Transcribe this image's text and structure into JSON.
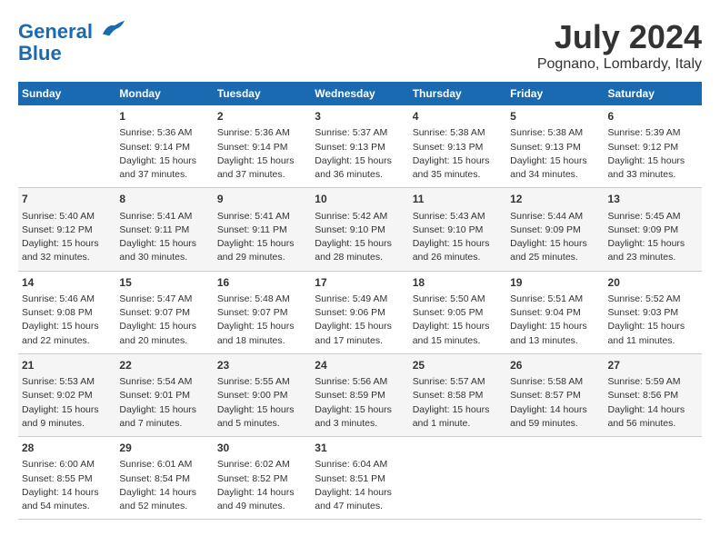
{
  "header": {
    "logo_line1": "General",
    "logo_line2": "Blue",
    "month_year": "July 2024",
    "location": "Pognano, Lombardy, Italy"
  },
  "columns": [
    "Sunday",
    "Monday",
    "Tuesday",
    "Wednesday",
    "Thursday",
    "Friday",
    "Saturday"
  ],
  "weeks": [
    [
      {
        "day": "",
        "sunrise": "",
        "sunset": "",
        "daylight": ""
      },
      {
        "day": "1",
        "sunrise": "Sunrise: 5:36 AM",
        "sunset": "Sunset: 9:14 PM",
        "daylight": "Daylight: 15 hours and 37 minutes."
      },
      {
        "day": "2",
        "sunrise": "Sunrise: 5:36 AM",
        "sunset": "Sunset: 9:14 PM",
        "daylight": "Daylight: 15 hours and 37 minutes."
      },
      {
        "day": "3",
        "sunrise": "Sunrise: 5:37 AM",
        "sunset": "Sunset: 9:13 PM",
        "daylight": "Daylight: 15 hours and 36 minutes."
      },
      {
        "day": "4",
        "sunrise": "Sunrise: 5:38 AM",
        "sunset": "Sunset: 9:13 PM",
        "daylight": "Daylight: 15 hours and 35 minutes."
      },
      {
        "day": "5",
        "sunrise": "Sunrise: 5:38 AM",
        "sunset": "Sunset: 9:13 PM",
        "daylight": "Daylight: 15 hours and 34 minutes."
      },
      {
        "day": "6",
        "sunrise": "Sunrise: 5:39 AM",
        "sunset": "Sunset: 9:12 PM",
        "daylight": "Daylight: 15 hours and 33 minutes."
      }
    ],
    [
      {
        "day": "7",
        "sunrise": "Sunrise: 5:40 AM",
        "sunset": "Sunset: 9:12 PM",
        "daylight": "Daylight: 15 hours and 32 minutes."
      },
      {
        "day": "8",
        "sunrise": "Sunrise: 5:41 AM",
        "sunset": "Sunset: 9:11 PM",
        "daylight": "Daylight: 15 hours and 30 minutes."
      },
      {
        "day": "9",
        "sunrise": "Sunrise: 5:41 AM",
        "sunset": "Sunset: 9:11 PM",
        "daylight": "Daylight: 15 hours and 29 minutes."
      },
      {
        "day": "10",
        "sunrise": "Sunrise: 5:42 AM",
        "sunset": "Sunset: 9:10 PM",
        "daylight": "Daylight: 15 hours and 28 minutes."
      },
      {
        "day": "11",
        "sunrise": "Sunrise: 5:43 AM",
        "sunset": "Sunset: 9:10 PM",
        "daylight": "Daylight: 15 hours and 26 minutes."
      },
      {
        "day": "12",
        "sunrise": "Sunrise: 5:44 AM",
        "sunset": "Sunset: 9:09 PM",
        "daylight": "Daylight: 15 hours and 25 minutes."
      },
      {
        "day": "13",
        "sunrise": "Sunrise: 5:45 AM",
        "sunset": "Sunset: 9:09 PM",
        "daylight": "Daylight: 15 hours and 23 minutes."
      }
    ],
    [
      {
        "day": "14",
        "sunrise": "Sunrise: 5:46 AM",
        "sunset": "Sunset: 9:08 PM",
        "daylight": "Daylight: 15 hours and 22 minutes."
      },
      {
        "day": "15",
        "sunrise": "Sunrise: 5:47 AM",
        "sunset": "Sunset: 9:07 PM",
        "daylight": "Daylight: 15 hours and 20 minutes."
      },
      {
        "day": "16",
        "sunrise": "Sunrise: 5:48 AM",
        "sunset": "Sunset: 9:07 PM",
        "daylight": "Daylight: 15 hours and 18 minutes."
      },
      {
        "day": "17",
        "sunrise": "Sunrise: 5:49 AM",
        "sunset": "Sunset: 9:06 PM",
        "daylight": "Daylight: 15 hours and 17 minutes."
      },
      {
        "day": "18",
        "sunrise": "Sunrise: 5:50 AM",
        "sunset": "Sunset: 9:05 PM",
        "daylight": "Daylight: 15 hours and 15 minutes."
      },
      {
        "day": "19",
        "sunrise": "Sunrise: 5:51 AM",
        "sunset": "Sunset: 9:04 PM",
        "daylight": "Daylight: 15 hours and 13 minutes."
      },
      {
        "day": "20",
        "sunrise": "Sunrise: 5:52 AM",
        "sunset": "Sunset: 9:03 PM",
        "daylight": "Daylight: 15 hours and 11 minutes."
      }
    ],
    [
      {
        "day": "21",
        "sunrise": "Sunrise: 5:53 AM",
        "sunset": "Sunset: 9:02 PM",
        "daylight": "Daylight: 15 hours and 9 minutes."
      },
      {
        "day": "22",
        "sunrise": "Sunrise: 5:54 AM",
        "sunset": "Sunset: 9:01 PM",
        "daylight": "Daylight: 15 hours and 7 minutes."
      },
      {
        "day": "23",
        "sunrise": "Sunrise: 5:55 AM",
        "sunset": "Sunset: 9:00 PM",
        "daylight": "Daylight: 15 hours and 5 minutes."
      },
      {
        "day": "24",
        "sunrise": "Sunrise: 5:56 AM",
        "sunset": "Sunset: 8:59 PM",
        "daylight": "Daylight: 15 hours and 3 minutes."
      },
      {
        "day": "25",
        "sunrise": "Sunrise: 5:57 AM",
        "sunset": "Sunset: 8:58 PM",
        "daylight": "Daylight: 15 hours and 1 minute."
      },
      {
        "day": "26",
        "sunrise": "Sunrise: 5:58 AM",
        "sunset": "Sunset: 8:57 PM",
        "daylight": "Daylight: 14 hours and 59 minutes."
      },
      {
        "day": "27",
        "sunrise": "Sunrise: 5:59 AM",
        "sunset": "Sunset: 8:56 PM",
        "daylight": "Daylight: 14 hours and 56 minutes."
      }
    ],
    [
      {
        "day": "28",
        "sunrise": "Sunrise: 6:00 AM",
        "sunset": "Sunset: 8:55 PM",
        "daylight": "Daylight: 14 hours and 54 minutes."
      },
      {
        "day": "29",
        "sunrise": "Sunrise: 6:01 AM",
        "sunset": "Sunset: 8:54 PM",
        "daylight": "Daylight: 14 hours and 52 minutes."
      },
      {
        "day": "30",
        "sunrise": "Sunrise: 6:02 AM",
        "sunset": "Sunset: 8:52 PM",
        "daylight": "Daylight: 14 hours and 49 minutes."
      },
      {
        "day": "31",
        "sunrise": "Sunrise: 6:04 AM",
        "sunset": "Sunset: 8:51 PM",
        "daylight": "Daylight: 14 hours and 47 minutes."
      },
      {
        "day": "",
        "sunrise": "",
        "sunset": "",
        "daylight": ""
      },
      {
        "day": "",
        "sunrise": "",
        "sunset": "",
        "daylight": ""
      },
      {
        "day": "",
        "sunrise": "",
        "sunset": "",
        "daylight": ""
      }
    ]
  ]
}
